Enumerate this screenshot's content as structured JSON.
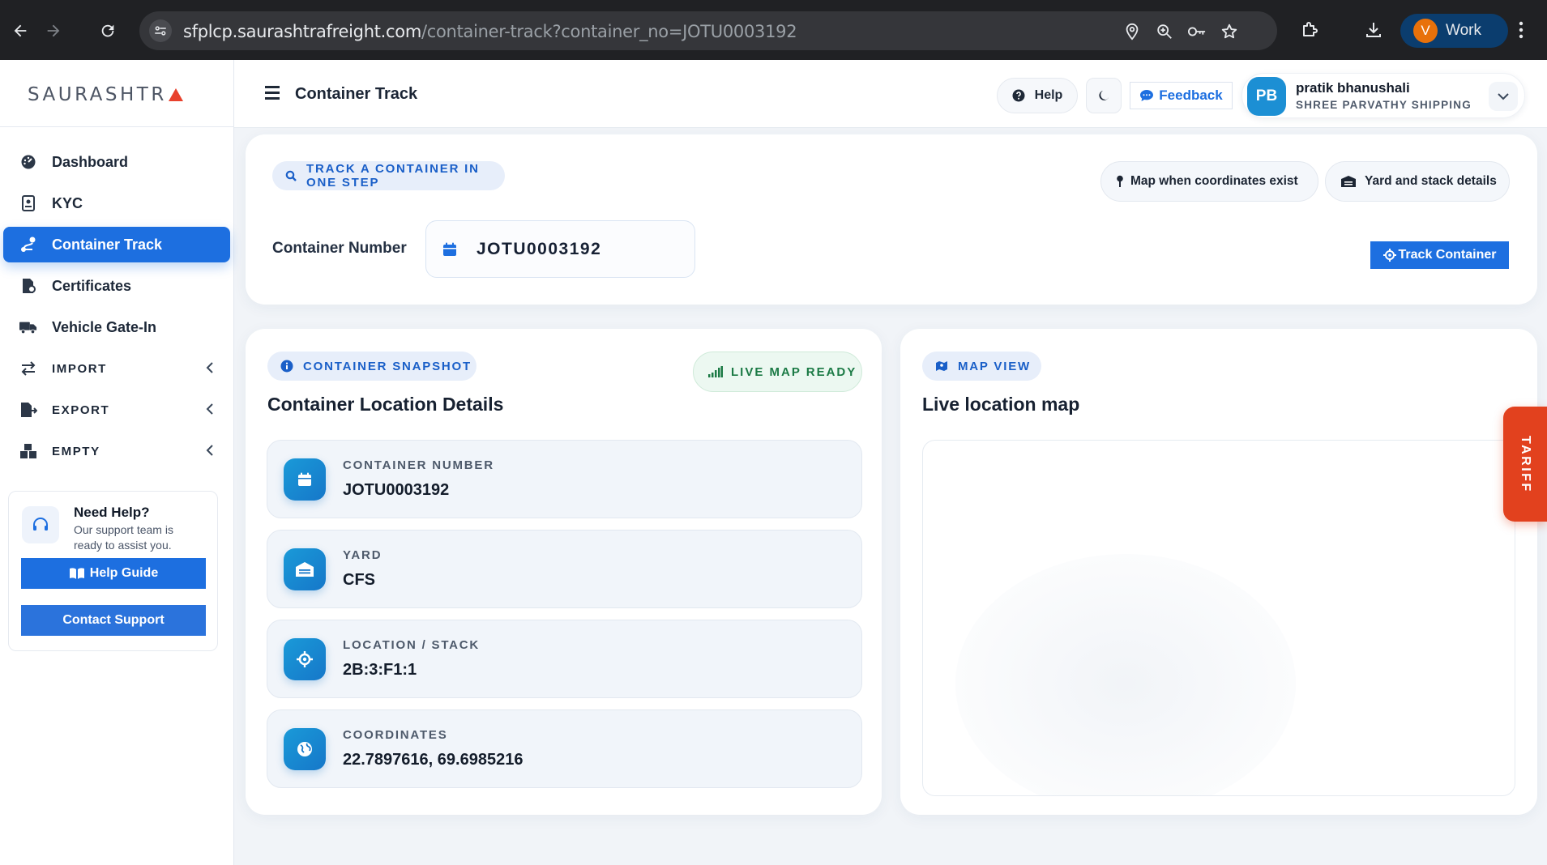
{
  "browser": {
    "url_host": "sfplcp.saurashtrafreight.com",
    "url_path": "/container-track?container_no=JOTU0003192",
    "profile_initial": "V",
    "profile_label": "Work"
  },
  "sidebar": {
    "logo": "SAURASHTR",
    "items": [
      {
        "label": "Dashboard",
        "icon": "dashboard-icon"
      },
      {
        "label": "KYC",
        "icon": "id-card-icon"
      },
      {
        "label": "Container Track",
        "icon": "route-icon",
        "active": true
      },
      {
        "label": "Certificates",
        "icon": "certificate-icon"
      },
      {
        "label": "Vehicle Gate-In",
        "icon": "truck-icon"
      },
      {
        "label": "IMPORT",
        "icon": "swap-arrows-icon"
      },
      {
        "label": "EXPORT",
        "icon": "file-export-icon"
      },
      {
        "label": "EMPTY",
        "icon": "boxes-icon"
      }
    ],
    "help": {
      "title": "Need Help?",
      "desc": "Our support team is ready to assist you.",
      "guide": "Help Guide",
      "support": "Contact Support"
    }
  },
  "header": {
    "title": "Container Track",
    "help": "Help",
    "feedback": "Feedback",
    "user": {
      "initials": "PB",
      "name": "pratik bhanushali",
      "company": "SHREE PARVATHY SHIPPING"
    }
  },
  "track": {
    "pill": "TRACK A CONTAINER IN ONE STEP",
    "tag_map": "Map when coordinates exist",
    "tag_yard": "Yard and stack details",
    "label": "Container Number",
    "value": "JOTU0003192",
    "button": "Track Container"
  },
  "snapshot": {
    "pill": "CONTAINER SNAPSHOT",
    "title": "Container Location Details",
    "badge": "LIVE MAP READY",
    "details": [
      {
        "label": "CONTAINER NUMBER",
        "value": "JOTU0003192"
      },
      {
        "label": "YARD",
        "value": "CFS"
      },
      {
        "label": "LOCATION / STACK",
        "value": "2B:3:F1:1"
      },
      {
        "label": "COORDINATES",
        "value": "22.7897616, 69.6985216"
      }
    ]
  },
  "map": {
    "pill": "MAP VIEW",
    "title": "Live location map"
  },
  "tariff": "TARIFF",
  "colors": {
    "primary": "#1d6fe0",
    "accent": "#e2411e",
    "success": "#1b7a45"
  }
}
